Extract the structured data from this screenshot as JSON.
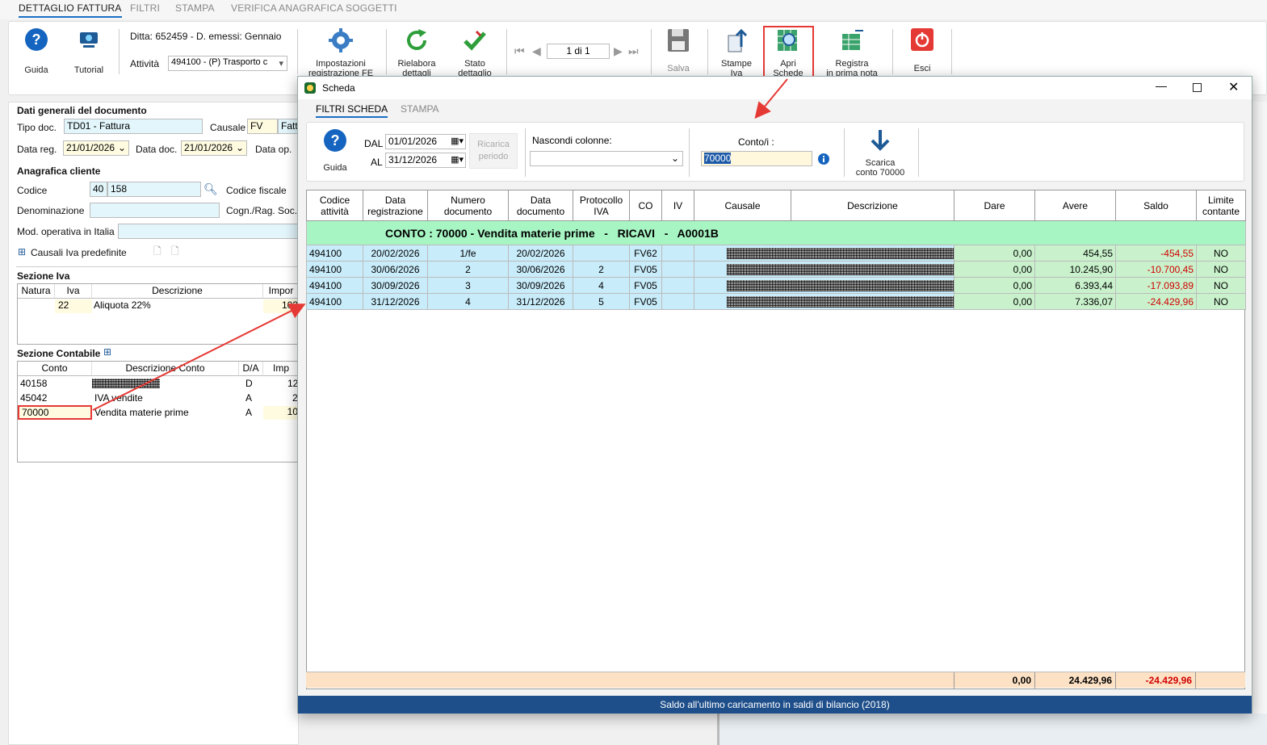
{
  "top_tabs": [
    "DETTAGLIO FATTURA",
    "FILTRI",
    "STAMPA",
    "VERIFICA ANAGRAFICA SOGGETTI"
  ],
  "ribbon": {
    "guida": "Guida",
    "tutorial": "Tutorial",
    "ditta": "Ditta: 652459 - D. emessi: Gennaio",
    "attivita_label": "Attività",
    "attivita_value": "494100 - (P) Trasporto c",
    "impostazioni_1": "Impostazioni",
    "impostazioni_2": "registrazione FE",
    "rielabora_1": "Rielabora",
    "rielabora_2": "dettagli",
    "stato_1": "Stato",
    "stato_2": "dettaglio",
    "pager": "1 di 1",
    "salva": "Salva",
    "stampe_1": "Stampe",
    "stampe_2": "Iva",
    "apri_1": "Apri",
    "apri_2": "Schede",
    "registra_1": "Registra",
    "registra_2": "in prima nota",
    "esci": "Esci"
  },
  "form": {
    "dati_generali": "Dati generali del documento",
    "tipo_doc_label": "Tipo doc.",
    "tipo_doc_value": "TD01 - Fattura",
    "causale_label": "Causale",
    "causale_code": "FV",
    "causale_desc": "Fatt",
    "data_reg_label": "Data reg.",
    "data_reg_value": "21/01/2026",
    "data_doc_label": "Data doc.",
    "data_doc_value": "21/01/2026",
    "data_op_label": "Data op.",
    "anagrafica": "Anagrafica cliente",
    "codice_label": "Codice",
    "codice_1": "40",
    "codice_2": "158",
    "codice_fiscale_label": "Codice fiscale",
    "denominazione_label": "Denominazione",
    "cognome_label": "Cogn./Rag. Soc.",
    "mod_operativa_label": "Mod. operativa in Italia",
    "causali_iva": "Causali Iva predefinite",
    "sezione_iva": "Sezione Iva",
    "iva_headers": [
      "Natura",
      "Iva",
      "Descrizione",
      "Impor"
    ],
    "iva_row": {
      "natura": "",
      "iva": "22",
      "descrizione": "Aliquota 22%",
      "importo": "103"
    },
    "sezione_contabile": "Sezione Contabile",
    "cont_headers": [
      "Conto",
      "Descrizione Conto",
      "D/A",
      "Imp"
    ],
    "cont_rows": [
      {
        "conto": "40158",
        "descrizione": "",
        "da": "D",
        "importo": "12"
      },
      {
        "conto": "45042",
        "descrizione": "IVA vendite",
        "da": "A",
        "importo": "2"
      },
      {
        "conto": "70000",
        "descrizione": "Vendita materie prime",
        "da": "A",
        "importo": "10"
      }
    ]
  },
  "dialog": {
    "title": "Scheda",
    "tabs": [
      "FILTRI SCHEDA",
      "STAMPA"
    ],
    "guida": "Guida",
    "dal_label": "DAL",
    "dal_value": "01/01/2026",
    "al_label": "AL",
    "al_value": "31/12/2026",
    "ricarica_1": "Ricarica",
    "ricarica_2": "periodo",
    "nascondi_label": "Nascondi colonne:",
    "conto_label": "Conto/i :",
    "conto_value": "70000",
    "scarica_1": "Scarica",
    "scarica_2": "conto 70000",
    "columns": [
      [
        "Codice",
        "attività"
      ],
      [
        "Data",
        "registrazione"
      ],
      [
        "Numero",
        "documento"
      ],
      [
        "Data",
        "documento"
      ],
      [
        "Protocollo",
        "IVA"
      ],
      [
        "CO",
        ""
      ],
      [
        "IV",
        ""
      ],
      [
        "Causale",
        ""
      ],
      [
        "Descrizione",
        ""
      ],
      [
        "Dare",
        ""
      ],
      [
        "Avere",
        ""
      ],
      [
        "Saldo",
        ""
      ],
      [
        "Limite",
        "contante"
      ]
    ],
    "group_header": "CONTO : 70000 - Vendita materie prime   -   RICAVI   -   A0001B",
    "rows": [
      {
        "attivita": "494100",
        "data_reg": "20/02/2026",
        "numero": "1/fe",
        "data_doc": "20/02/2026",
        "protocollo": "",
        "co": "FV62",
        "iv": "",
        "dare": "0,00",
        "avere": "454,55",
        "saldo": "-454,55",
        "limite": "NO"
      },
      {
        "attivita": "494100",
        "data_reg": "30/06/2026",
        "numero": "2",
        "data_doc": "30/06/2026",
        "protocollo": "2",
        "co": "FV05",
        "iv": "",
        "dare": "0,00",
        "avere": "10.245,90",
        "saldo": "-10.700,45",
        "limite": "NO"
      },
      {
        "attivita": "494100",
        "data_reg": "30/09/2026",
        "numero": "3",
        "data_doc": "30/09/2026",
        "protocollo": "4",
        "co": "FV05",
        "iv": "",
        "dare": "0,00",
        "avere": "6.393,44",
        "saldo": "-17.093,89",
        "limite": "NO"
      },
      {
        "attivita": "494100",
        "data_reg": "31/12/2026",
        "numero": "4",
        "data_doc": "31/12/2026",
        "protocollo": "5",
        "co": "FV05",
        "iv": "",
        "dare": "0,00",
        "avere": "7.336,07",
        "saldo": "-24.429,96",
        "limite": "NO"
      }
    ],
    "totals": {
      "dare": "0,00",
      "avere": "24.429,96",
      "saldo": "-24.429,96"
    },
    "status": "Saldo all'ultimo caricamento in saldi di bilancio (2018)"
  },
  "colors": {
    "accent": "#1a6fc4",
    "highlight_red": "#e53935",
    "status_bar": "#1f4f8a",
    "row_blue": "#c8ecfa",
    "row_green": "#c9f2cc",
    "group_green": "#a8f5c4",
    "total_peach": "#fde1c4"
  }
}
